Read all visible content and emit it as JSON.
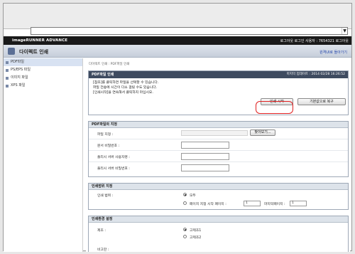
{
  "browser": {
    "address_value": "",
    "dropdown_icon": "chevron-down-icon"
  },
  "topbar": {
    "logo": "imageRUNNER ADVANCE",
    "user_text": "로그인 사용자 : 7654321",
    "login_link": "로그아웃",
    "logout_label": "로그아웃"
  },
  "header": {
    "title": "다이렉트 인쇄",
    "link": "원격UI로 돌아가기"
  },
  "sidebar": {
    "items": [
      {
        "label": "PDF파일"
      },
      {
        "label": "PS/EPS 파일"
      },
      {
        "label": "이미지 파일"
      },
      {
        "label": "XPS 파일"
      }
    ]
  },
  "breadcrumb": "다이렉트 인쇄 : PDF파일 인쇄",
  "panel": {
    "title": "PDF파일 인쇄",
    "timestamp": "마지막 업데이트 : 2014 02/28 16:26:52",
    "message_lines": [
      "[참조]를 클릭하면 파일을 선택할 수 있습니다.",
      "파일 전송에 시간이 다소 걸릴 수도 있습니다.",
      "[인쇄시작]을 연속해서 클릭하지 마십시오."
    ],
    "start_button": "인쇄 시작",
    "reset_button": "기본값으로 복구"
  },
  "pdf_settings": {
    "section_title": "PDF파일의 지정",
    "file_label": "파일 지정 :",
    "browse_button": "찾아보기...",
    "doc_password_label": "문서 비밀번호 :",
    "pull_user_label": "풀리시 서버 사용자명 :",
    "pull_password_label": "풀리시 서버 비밀번호 :"
  },
  "print_range": {
    "section_title": "인쇄범위 지정",
    "label": "인쇄 범위 :",
    "option_all": "모두",
    "option_pages": "페이지 지정  시작 페이지 :",
    "start_page_value": "1",
    "end_page_label": "마지막페이지 :",
    "end_page_value": "1"
  },
  "print_settings": {
    "section_title": "인쇄환경 설정",
    "color_label": "제조 :",
    "option1": "고제조1",
    "option2": "고제조2",
    "note_label": "비고란 :"
  }
}
